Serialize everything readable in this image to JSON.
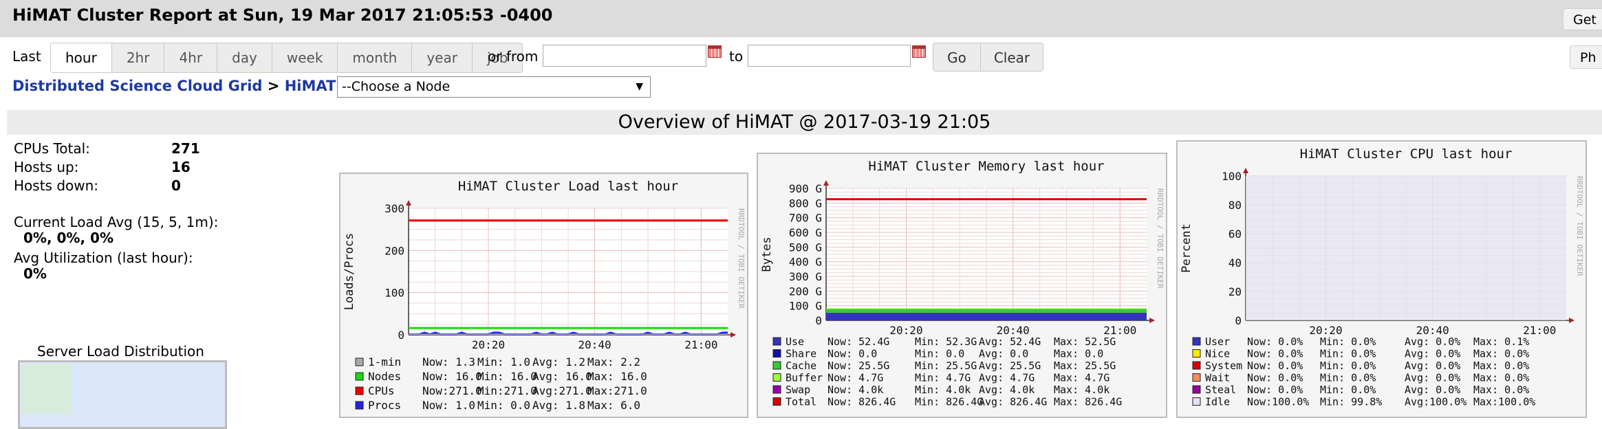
{
  "page": {
    "title": "HiMAT Cluster Report at Sun, 19 Mar 2017 21:05:53 -0400",
    "get_label": "Get",
    "ph_label": "Ph"
  },
  "controls": {
    "last_label": "Last",
    "ranges": [
      "hour",
      "2hr",
      "4hr",
      "day",
      "week",
      "month",
      "year",
      "job"
    ],
    "selected_range": "hour",
    "or_from_label": "or from",
    "to_label": "to",
    "from_value": "",
    "to_value": "",
    "go_label": "Go",
    "clear_label": "Clear"
  },
  "breadcrumb": {
    "grid": "Distributed Science Cloud Grid",
    "sep1": ">",
    "cluster": "HiMAT",
    "sep2": ">",
    "node_select": "--Choose a Node"
  },
  "overview_title": "Overview of HiMAT @ 2017-03-19 21:05",
  "stats": {
    "cpus_total_label": "CPUs Total:",
    "cpus_total": "271",
    "hosts_up_label": "Hosts up:",
    "hosts_up": "16",
    "hosts_down_label": "Hosts down:",
    "hosts_down": "0",
    "load_avg_label": "Current Load Avg (15, 5, 1m):",
    "load_avg": "0%, 0%, 0%",
    "util_label": "Avg Utilization (last hour):",
    "util": "0%"
  },
  "server_load_title": "Server Load Distribution",
  "watermark": "RRDTOOL / TOBI OETIKER",
  "graphs": {
    "load": {
      "title": "HiMAT Cluster Load last hour",
      "ylabel": "Loads/Procs",
      "yticks": [
        "0",
        "100",
        "200",
        "300"
      ],
      "xticks": [
        "20:20",
        "20:40",
        "21:00"
      ],
      "legend": [
        {
          "name": "1-min",
          "color": "#aaaaaa",
          "now": "Now:   1.3",
          "min": "Min:   1.0",
          "avg": "Avg:   1.2",
          "max": "Max:   2.2"
        },
        {
          "name": "Nodes",
          "color": "#11dd11",
          "now": "Now:  16.0",
          "min": "Min:  16.0",
          "avg": "Avg:  16.0",
          "max": "Max:  16.0"
        },
        {
          "name": "CPUs",
          "color": "#ee0000",
          "now": "Now:271.0",
          "min": "Min:271.0",
          "avg": "Avg:271.0",
          "max": "Max:271.0"
        },
        {
          "name": "Procs",
          "color": "#2222ee",
          "now": "Now:   1.0",
          "min": "Min:   0.0",
          "avg": "Avg:   1.8",
          "max": "Max:   6.0"
        }
      ]
    },
    "memory": {
      "title": "HiMAT Cluster Memory last hour",
      "ylabel": "Bytes",
      "yticks": [
        "0",
        "100 G",
        "200 G",
        "300 G",
        "400 G",
        "500 G",
        "600 G",
        "700 G",
        "800 G",
        "900 G"
      ],
      "xticks": [
        "20:20",
        "20:40",
        "21:00"
      ],
      "legend": [
        {
          "name": "Use",
          "color": "#3333bb",
          "now": "Now:  52.4G",
          "min": "Min:  52.3G",
          "avg": "Avg:  52.4G",
          "max": "Max:  52.5G"
        },
        {
          "name": "Share",
          "color": "#1111aa",
          "now": "Now:    0.0",
          "min": "Min:    0.0",
          "avg": "Avg:    0.0",
          "max": "Max:    0.0"
        },
        {
          "name": "Cache",
          "color": "#33cc33",
          "now": "Now:  25.5G",
          "min": "Min:  25.5G",
          "avg": "Avg:  25.5G",
          "max": "Max:  25.5G"
        },
        {
          "name": "Buffer",
          "color": "#99ff33",
          "now": "Now:   4.7G",
          "min": "Min:   4.7G",
          "avg": "Avg:   4.7G",
          "max": "Max:   4.7G"
        },
        {
          "name": "Swap",
          "color": "#9900aa",
          "now": "Now:   4.0k",
          "min": "Min:   4.0k",
          "avg": "Avg:   4.0k",
          "max": "Max:   4.0k"
        },
        {
          "name": "Total",
          "color": "#dd0000",
          "now": "Now: 826.4G",
          "min": "Min: 826.4G",
          "avg": "Avg: 826.4G",
          "max": "Max: 826.4G"
        }
      ]
    },
    "cpu": {
      "title": "HiMAT Cluster CPU last hour",
      "ylabel": "Percent",
      "yticks": [
        "0",
        "20",
        "40",
        "60",
        "80",
        "100"
      ],
      "xticks": [
        "20:20",
        "20:40",
        "21:00"
      ],
      "legend": [
        {
          "name": "User",
          "color": "#3333bb",
          "now": "Now:   0.0%",
          "min": "Min:   0.0%",
          "avg": "Avg:   0.0%",
          "max": "Max:   0.1%"
        },
        {
          "name": "Nice",
          "color": "#ffea00",
          "now": "Now:   0.0%",
          "min": "Min:   0.0%",
          "avg": "Avg:   0.0%",
          "max": "Max:   0.0%"
        },
        {
          "name": "System",
          "color": "#dd0000",
          "now": "Now:   0.0%",
          "min": "Min:   0.0%",
          "avg": "Avg:   0.0%",
          "max": "Max:   0.0%"
        },
        {
          "name": "Wait",
          "color": "#ff8a60",
          "now": "Now:   0.0%",
          "min": "Min:   0.0%",
          "avg": "Avg:   0.0%",
          "max": "Max:   0.0%"
        },
        {
          "name": "Steal",
          "color": "#990099",
          "now": "Now:   0.0%",
          "min": "Min:   0.0%",
          "avg": "Avg:   0.0%",
          "max": "Max:   0.0%"
        },
        {
          "name": "Idle",
          "color": "#e2e2f2",
          "now": "Now:100.0%",
          "min": "Min:  99.8%",
          "avg": "Avg:100.0%",
          "max": "Max:100.0%"
        }
      ]
    }
  },
  "chart_data": [
    {
      "type": "line",
      "title": "HiMAT Cluster Load last hour",
      "ylabel": "Loads/Procs",
      "ylim": [
        0,
        300
      ],
      "x": [
        "20:20",
        "20:40",
        "21:00"
      ],
      "series": [
        {
          "name": "1-min",
          "values": [
            1.2,
            1.2,
            1.3
          ]
        },
        {
          "name": "Nodes",
          "values": [
            16,
            16,
            16
          ]
        },
        {
          "name": "CPUs",
          "values": [
            271,
            271,
            271
          ]
        },
        {
          "name": "Procs",
          "values": [
            1.0,
            3.0,
            1.0
          ]
        }
      ]
    },
    {
      "type": "area",
      "title": "HiMAT Cluster Memory last hour",
      "ylabel": "Bytes",
      "ylim": [
        0,
        900
      ],
      "x": [
        "20:20",
        "20:40",
        "21:00"
      ],
      "series": [
        {
          "name": "Use",
          "values": [
            52.4,
            52.4,
            52.4
          ]
        },
        {
          "name": "Share",
          "values": [
            0,
            0,
            0
          ]
        },
        {
          "name": "Cache",
          "values": [
            25.5,
            25.5,
            25.5
          ]
        },
        {
          "name": "Buffer",
          "values": [
            4.7,
            4.7,
            4.7
          ]
        },
        {
          "name": "Swap",
          "values": [
            0,
            0,
            0
          ]
        },
        {
          "name": "Total",
          "values": [
            826.4,
            826.4,
            826.4
          ]
        }
      ]
    },
    {
      "type": "area",
      "title": "HiMAT Cluster CPU last hour",
      "ylabel": "Percent",
      "ylim": [
        0,
        100
      ],
      "x": [
        "20:20",
        "20:40",
        "21:00"
      ],
      "series": [
        {
          "name": "User",
          "values": [
            0,
            0,
            0
          ]
        },
        {
          "name": "Nice",
          "values": [
            0,
            0,
            0
          ]
        },
        {
          "name": "System",
          "values": [
            0,
            0,
            0
          ]
        },
        {
          "name": "Wait",
          "values": [
            0,
            0,
            0
          ]
        },
        {
          "name": "Steal",
          "values": [
            0,
            0,
            0
          ]
        },
        {
          "name": "Idle",
          "values": [
            100,
            100,
            100
          ]
        }
      ]
    }
  ]
}
